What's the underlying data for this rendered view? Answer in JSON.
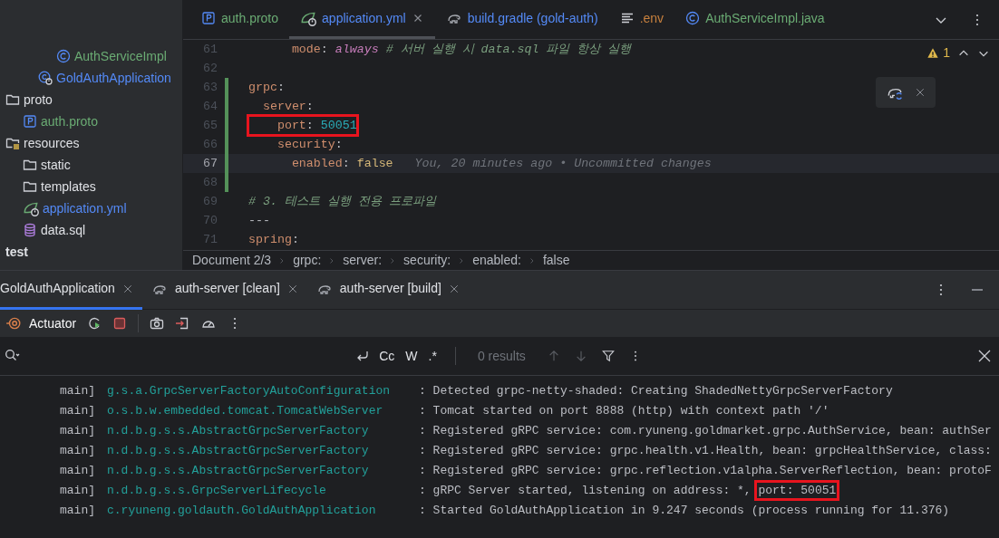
{
  "project_tree": [
    {
      "label": "AuthServiceImpl",
      "kind": "class",
      "color": "#6aab73"
    },
    {
      "label": "GoldAuthApplication",
      "kind": "app",
      "color": "#548af7"
    },
    {
      "label": "proto",
      "kind": "folder",
      "color": "#dfe1e5",
      "children": [
        {
          "label": "auth.proto",
          "kind": "proto",
          "color": "#6aab73"
        }
      ]
    },
    {
      "label": "resources",
      "kind": "resources",
      "color": "#dfe1e5",
      "children": [
        {
          "label": "static",
          "kind": "folder",
          "color": "#dfe1e5"
        },
        {
          "label": "templates",
          "kind": "folder",
          "color": "#dfe1e5"
        },
        {
          "label": "application.yml",
          "kind": "spring",
          "color": "#548af7"
        },
        {
          "label": "data.sql",
          "kind": "database",
          "color": "#dfe1e5"
        }
      ]
    },
    {
      "label": "test",
      "kind": "module",
      "color": "#dfe1e5",
      "bold": true
    }
  ],
  "editor": {
    "tabs": [
      {
        "label": "auth.proto",
        "kind": "proto",
        "color": "#6aab73",
        "selected": false,
        "closable": false
      },
      {
        "label": "application.yml",
        "kind": "spring",
        "color": "#548af7",
        "selected": true,
        "closable": true
      },
      {
        "label": "build.gradle (gold-auth)",
        "kind": "gradle",
        "color": "#548af7",
        "selected": false,
        "closable": false
      },
      {
        "label": ".env",
        "kind": "text",
        "color": "#c7803e",
        "selected": false,
        "closable": false
      },
      {
        "label": "AuthServiceImpl.java",
        "kind": "class",
        "color": "#6aab73",
        "selected": false,
        "closable": false
      }
    ],
    "warnings": "1",
    "lines": [
      {
        "number": "61",
        "changed": false,
        "current": false,
        "boxed": false,
        "tokens": [
          {
            "text": "      mode",
            "kind": "key"
          },
          {
            "text": ": ",
            "kind": "punct"
          },
          {
            "text": "always",
            "kind": "constant"
          },
          {
            "text": " # 서버 실행 시 data.sql 파일 항상 실행",
            "kind": "comment"
          }
        ]
      },
      {
        "number": "62",
        "changed": false,
        "current": false,
        "boxed": false
      },
      {
        "number": "63",
        "changed": true,
        "current": false,
        "boxed": false,
        "tokens": [
          {
            "text": "grpc",
            "kind": "key"
          },
          {
            "text": ":",
            "kind": "punct"
          }
        ]
      },
      {
        "number": "64",
        "changed": true,
        "current": false,
        "boxed": false,
        "tokens": [
          {
            "text": "  server",
            "kind": "key"
          },
          {
            "text": ":",
            "kind": "punct"
          }
        ]
      },
      {
        "number": "65",
        "changed": true,
        "current": false,
        "boxed": true,
        "tokens": [
          {
            "text": "    port",
            "kind": "key"
          },
          {
            "text": ": ",
            "kind": "punct"
          },
          {
            "text": "50051",
            "kind": "number"
          }
        ]
      },
      {
        "number": "66",
        "changed": true,
        "current": false,
        "boxed": false,
        "tokens": [
          {
            "text": "    security",
            "kind": "key"
          },
          {
            "text": ":",
            "kind": "punct"
          }
        ]
      },
      {
        "number": "67",
        "changed": true,
        "current": true,
        "boxed": false,
        "tokens": [
          {
            "text": "      enabled",
            "kind": "key"
          },
          {
            "text": ": ",
            "kind": "punct"
          },
          {
            "text": "false",
            "kind": "bool"
          }
        ],
        "blame": "You, 20 minutes ago • Uncommitted changes"
      },
      {
        "number": "68",
        "changed": true,
        "current": false,
        "boxed": false
      },
      {
        "number": "69",
        "changed": false,
        "current": false,
        "boxed": false,
        "tokens": [
          {
            "text": "# 3. 테스트 실행 전용 프로파일",
            "kind": "comment"
          }
        ]
      },
      {
        "number": "70",
        "changed": false,
        "current": false,
        "boxed": false,
        "tokens": [
          {
            "text": "---",
            "kind": "punct"
          }
        ]
      },
      {
        "number": "71",
        "changed": false,
        "current": false,
        "boxed": false,
        "tokens": [
          {
            "text": "spring",
            "kind": "key"
          },
          {
            "text": ":",
            "kind": "punct"
          }
        ]
      }
    ],
    "breadcrumb": [
      "Document 2/3",
      "grpc:",
      "server:",
      "security:",
      "enabled:",
      "false"
    ]
  },
  "run_panel": {
    "tabs": [
      {
        "label": "GoldAuthApplication",
        "kind": "app",
        "selected": true
      },
      {
        "label": "auth-server [clean]",
        "kind": "gradle",
        "selected": false
      },
      {
        "label": "auth-server [build]",
        "kind": "gradle",
        "selected": false
      }
    ],
    "toolbar_label": "Actuator",
    "search_options": [
      "Cc",
      "W",
      ".*"
    ],
    "results": "0 results",
    "log": [
      {
        "thread": "main]",
        "logger": "g.s.a.GrpcServerFactoryAutoConfiguration",
        "message": ": Detected grpc-netty-shaded: Creating ShadedNettyGrpcServerFactory"
      },
      {
        "thread": "main]",
        "logger": "o.s.b.w.embedded.tomcat.TomcatWebServer",
        "message": ": Tomcat started on port 8888 (http) with context path '/'"
      },
      {
        "thread": "main]",
        "logger": "n.d.b.g.s.s.AbstractGrpcServerFactory",
        "message": ": Registered gRPC service: com.ryuneng.goldmarket.grpc.AuthService, bean: authSer"
      },
      {
        "thread": "main]",
        "logger": "n.d.b.g.s.s.AbstractGrpcServerFactory",
        "message": ": Registered gRPC service: grpc.health.v1.Health, bean: grpcHealthService, class:"
      },
      {
        "thread": "main]",
        "logger": "n.d.b.g.s.s.AbstractGrpcServerFactory",
        "message": ": Registered gRPC service: grpc.reflection.v1alpha.ServerReflection, bean: protoF"
      },
      {
        "thread": "main]",
        "logger": "n.d.b.g.s.s.GrpcServerLifecycle",
        "message": ": gRPC Server started, listening on address: *, ",
        "boxed": "port: 50051"
      },
      {
        "thread": "main]",
        "logger": "c.ryuneng.goldauth.GoldAuthApplication",
        "message": ": Started GoldAuthApplication in 9.247 seconds (process running for 11.376)"
      }
    ]
  }
}
